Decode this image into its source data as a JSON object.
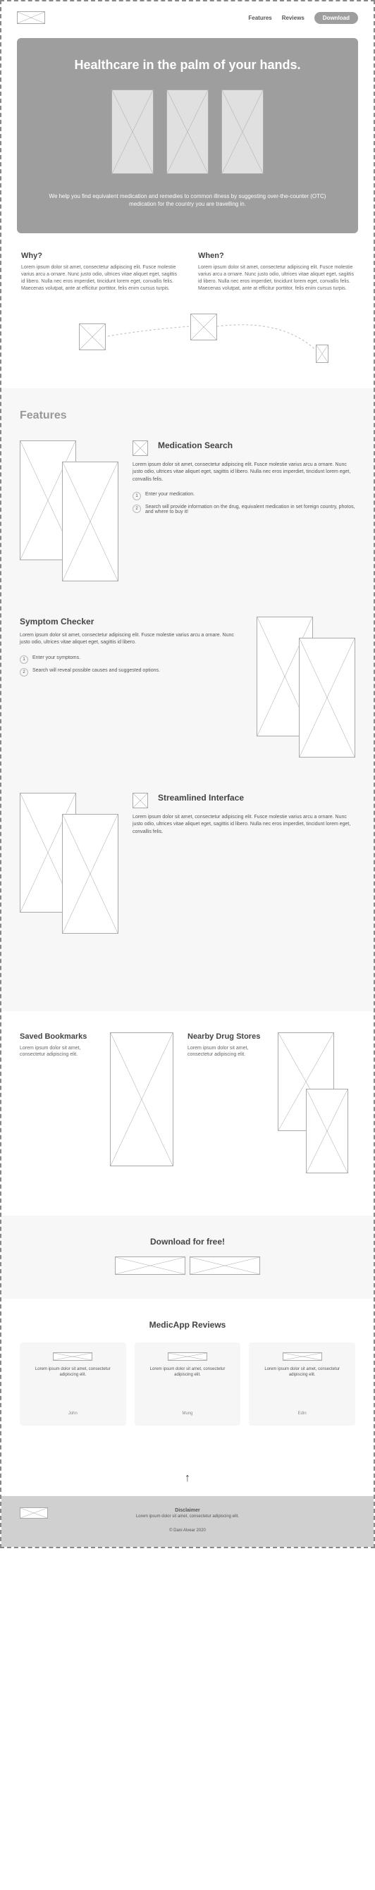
{
  "nav": {
    "features": "Features",
    "reviews": "Reviews",
    "download": "Download"
  },
  "hero": {
    "title": "Healthcare in the palm of your hands.",
    "subtitle": "We help you find equivalent medication and remedies to common illness by suggesting over-the-counter (OTC) medication for the country you are travelling in."
  },
  "why": {
    "title": "Why?",
    "body": "Lorem ipsum dolor sit amet, consectetur adipiscing elit. Fusce molestie varius arcu a ornare. Nunc justo odio, ultrices vitae aliquet eget, sagittis id libero. Nulla nec eros imperdiet, tincidunt lorem eget, convallis felis. Maecenas volutpat, ante at efficitur porttitor, felis enim cursus turpis."
  },
  "when": {
    "title": "When?",
    "body": "Lorem ipsum dolor sit amet, consectetur adipiscing elit. Fusce molestie varius arcu a ornare. Nunc justo odio, ultrices vitae aliquet eget, sagittis id libero. Nulla nec eros imperdiet, tincidunt lorem eget, convallis felis. Maecenas volutpat, ante at efficitur porttitor, felis enim cursus turpis."
  },
  "features": {
    "heading": "Features",
    "items": [
      {
        "title": "Medication Search",
        "body": "Lorem ipsum dolor sit amet, consectetur adipiscing elit. Fusce molestie varius arcu a ornare. Nunc justo odio, ultrices vitae aliquet eget, sagittis id libero. Nulla nec eros imperdiet, tincidunt lorem eget, convallis felis.",
        "steps": [
          "Enter your medication.",
          "Search will provide information on the drug, equivalent medication in set foreign country, photos, and where to buy it!"
        ]
      },
      {
        "title": "Symptom Checker",
        "body": "Lorem ipsum dolor sit amet, consectetur adipiscing elit. Fusce molestie varius arcu a ornare. Nunc justo odio, ultrices vitae aliquet eget, sagittis id libero.",
        "steps": [
          "Enter your symptoms.",
          "Search will reveal possible causes and suggested options."
        ]
      },
      {
        "title": "Streamlined Interface",
        "body": "Lorem ipsum dolor sit amet, consectetur adipiscing elit. Fusce molestie varius arcu a ornare. Nunc justo odio, ultrices vitae aliquet eget, sagittis id libero. Nulla nec eros imperdiet, tincidunt lorem eget, convallis felis."
      }
    ]
  },
  "bookmarks": {
    "title": "Saved Bookmarks",
    "body": "Lorem ipsum dolor sit amet, consectetur adipiscing elit."
  },
  "drugstores": {
    "title": "Nearby Drug Stores",
    "body": "Lorem ipsum dolor sit amet, consectetur adipiscing elit."
  },
  "download": {
    "title": "Download for free!"
  },
  "reviews": {
    "title": "MedicApp Reviews",
    "items": [
      {
        "text": "Lorem ipsum dolor sit amet, consectetur adipiscing elit.",
        "author": "John"
      },
      {
        "text": "Lorem ipsum dolor sit amet, consectetur adipiscing elit.",
        "author": "Mung"
      },
      {
        "text": "Lorem ipsum dolor sit amet, consectetur adipiscing elit.",
        "author": "Edin"
      }
    ]
  },
  "footer": {
    "disclaimer_title": "Disclaimer",
    "disclaimer_body": "Lorem ipsum dolor sit amet, consectetur adipiscing elit.",
    "copy": "© Dani Alvear 2020"
  }
}
